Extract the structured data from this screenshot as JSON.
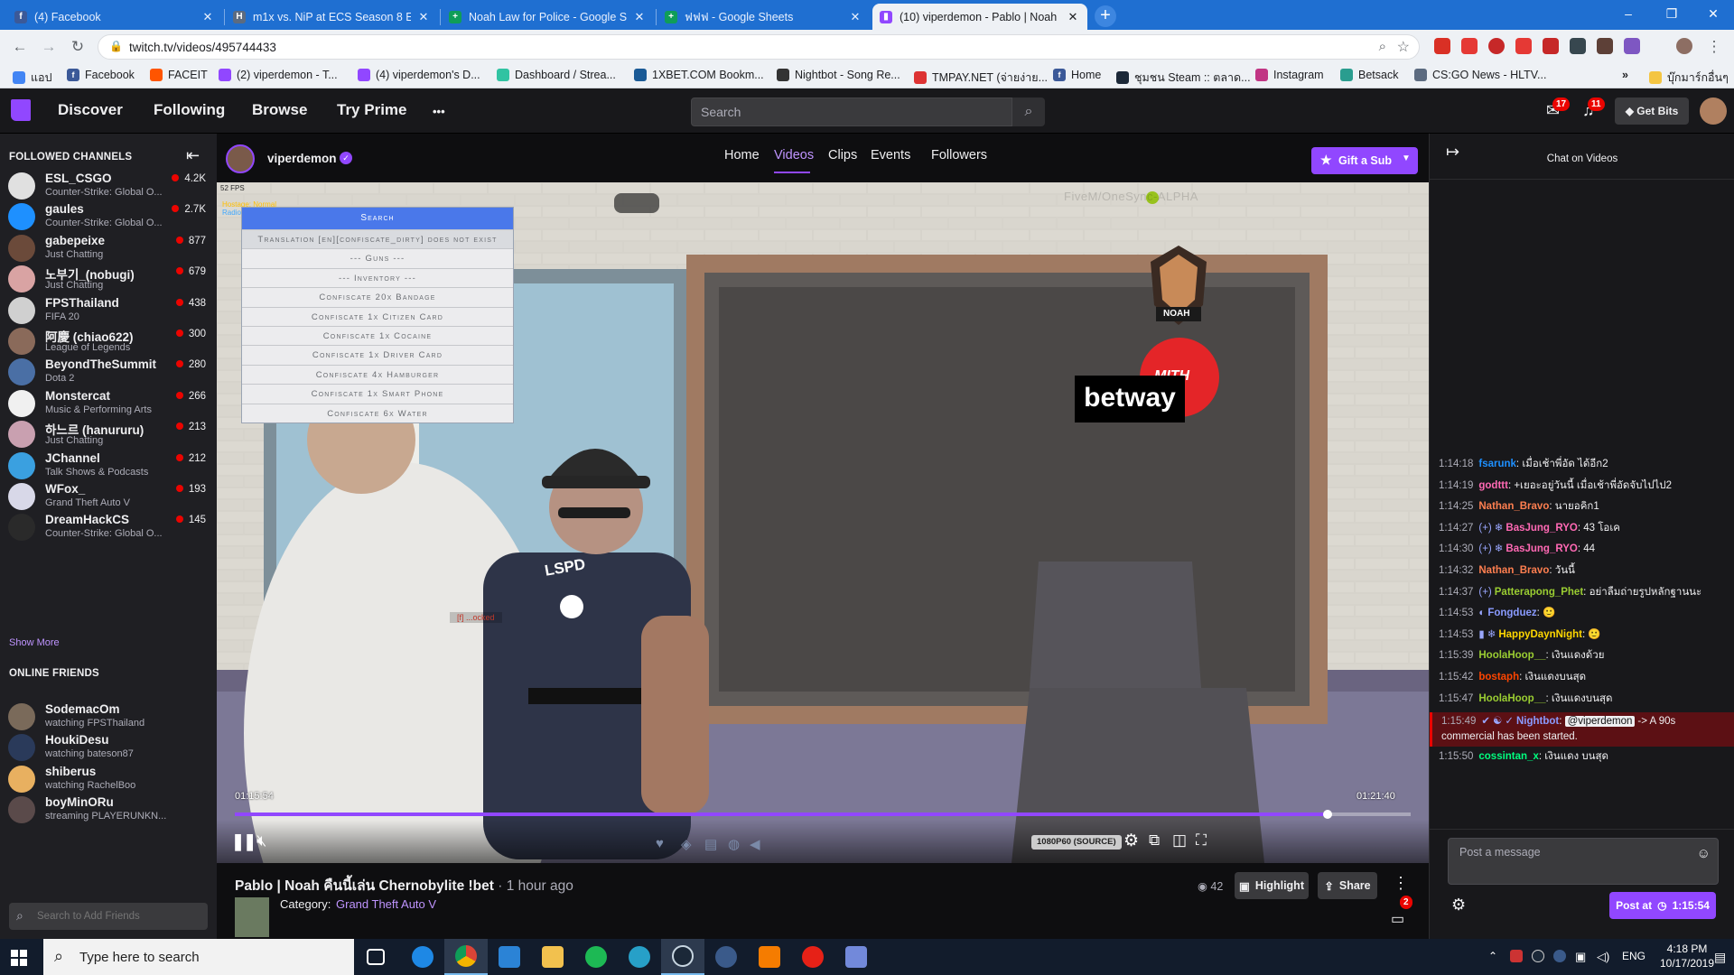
{
  "browser": {
    "tabs": [
      {
        "title": "(4) Facebook",
        "icon": "facebook-icon",
        "color": "#3b5998"
      },
      {
        "title": "m1x vs. NiP at ECS Season 8 Euro",
        "icon": "hltv-icon",
        "color": "#5c6b80"
      },
      {
        "title": "Noah Law for Police - Google She",
        "icon": "sheets-icon",
        "color": "#0f9d58"
      },
      {
        "title": "ฟฟฟ - Google Sheets",
        "icon": "sheets-icon",
        "color": "#0f9d58"
      },
      {
        "title": "(10) viperdemon - Pablo | Noah",
        "icon": "twitch-icon",
        "color": "#9147ff",
        "active": true
      }
    ],
    "new_tab": "+",
    "url": "twitch.tv/videos/495744433",
    "window_buttons": [
      "–",
      "❐",
      "✕"
    ],
    "bookmarks": [
      {
        "label": "แอป",
        "color": "#4285f4"
      },
      {
        "label": "Facebook",
        "color": "#3b5998"
      },
      {
        "label": "FACEIT",
        "color": "#ff5500"
      },
      {
        "label": "(2) viperdemon - T...",
        "color": "#9147ff"
      },
      {
        "label": "(4) viperdemon's D...",
        "color": "#9147ff"
      },
      {
        "label": "Dashboard / Strea...",
        "color": "#31c3a2"
      },
      {
        "label": "1XBET.COM Bookm...",
        "color": "#1a5a96"
      },
      {
        "label": "Nightbot - Song Re...",
        "color": "#333333"
      },
      {
        "label": "TMPAY.NET (จ่ายง่าย...",
        "color": "#d33"
      },
      {
        "label": "Home",
        "color": "#3b5998"
      },
      {
        "label": "ชุมชน Steam :: ตลาด...",
        "color": "#1b2838"
      },
      {
        "label": "Instagram",
        "color": "#c13584"
      },
      {
        "label": "Betsack",
        "color": "#2a9d8f"
      },
      {
        "label": "CS:GO News - HLTV...",
        "color": "#5c6b80"
      },
      {
        "label": "»",
        "color": ""
      },
      {
        "label": "บุ๊กมาร์กอื่นๆ",
        "color": "#f4c542"
      }
    ]
  },
  "twitch": {
    "nav": {
      "discover": "Discover",
      "following": "Following",
      "browse": "Browse",
      "try_prime": "Try Prime",
      "more": "•••"
    },
    "search_placeholder": "Search",
    "inbox_count": "17",
    "notif_count": "11",
    "get_bits": "Get Bits",
    "colors": {
      "purple": "#9147ff",
      "live": "#eb0400"
    }
  },
  "sidebar": {
    "followed_header": "FOLLOWED CHANNELS",
    "collapse_icon": "⇤",
    "channels": [
      {
        "name": "ESL_CSGO",
        "game": "Counter-Strike: Global O...",
        "viewers": "4.2K",
        "color": "#e0e0e0"
      },
      {
        "name": "gaules",
        "game": "Counter-Strike: Global O...",
        "viewers": "2.7K",
        "color": "#1e90ff"
      },
      {
        "name": "gabepeixe",
        "game": "Just Chatting",
        "viewers": "877",
        "color": "#6b4a3a"
      },
      {
        "name": "노부기_(nobugi)",
        "game": "Just Chatting",
        "viewers": "679",
        "color": "#d9a3a3"
      },
      {
        "name": "FPSThailand",
        "game": "FIFA 20",
        "viewers": "438",
        "color": "#d0d0d0"
      },
      {
        "name": "阿慶 (chiao622)",
        "game": "League of Legends",
        "viewers": "300",
        "color": "#8a6a5a"
      },
      {
        "name": "BeyondTheSummit",
        "game": "Dota 2",
        "viewers": "280",
        "color": "#4a6fa5"
      },
      {
        "name": "Monstercat",
        "game": "Music & Performing Arts",
        "viewers": "266",
        "color": "#f0f0f0"
      },
      {
        "name": "하느르 (hanururu)",
        "game": "Just Chatting",
        "viewers": "213",
        "color": "#c9a0b0"
      },
      {
        "name": "JChannel",
        "game": "Talk Shows & Podcasts",
        "viewers": "212",
        "color": "#3aa0e0"
      },
      {
        "name": "WFox_",
        "game": "Grand Theft Auto V",
        "viewers": "193",
        "color": "#d8d8e8"
      },
      {
        "name": "DreamHackCS",
        "game": "Counter-Strike: Global O...",
        "viewers": "145",
        "color": "#2a2a2a"
      }
    ],
    "show_more": "Show More",
    "friends_header": "ONLINE FRIENDS",
    "friends": [
      {
        "name": "SodemacOm",
        "status": "watching FPSThailand",
        "color": "#7a6a5a"
      },
      {
        "name": "HoukiDesu",
        "status": "watching bateson87",
        "color": "#2a3a5a"
      },
      {
        "name": "shiberus",
        "status": "watching RachelBoo",
        "color": "#e8b060"
      },
      {
        "name": "boyMinORu",
        "status": "streaming PLAYERUNKN...",
        "color": "#5a4a4a"
      }
    ],
    "search_friends_placeholder": "Search to Add Friends"
  },
  "channel": {
    "name": "viperdemon",
    "verified": "✓",
    "tabs": [
      "Home",
      "Videos",
      "Clips",
      "Events",
      "Followers"
    ],
    "active_tab": "Videos",
    "gift_sub": "Gift a Sub"
  },
  "video": {
    "fps": "52 FPS",
    "hud_top": "Hostage: Normal",
    "hud_sub": "Radio: LSPD Radio",
    "server_watermark": "FiveM/OneSync-ALPHA",
    "menu_title": "Search",
    "menu_items": [
      "Translation [en][confiscate_dirty] does not exist",
      "--- Guns ---",
      "--- Inventory ---",
      "Confiscate 20x Bandage",
      "Confiscate 1x Citizen Card",
      "Confiscate 1x Cocaine",
      "Confiscate 1x Driver Card",
      "Confiscate 4x Hamburger",
      "Confiscate 1x Smart Phone",
      "Confiscate 6x Water"
    ],
    "sponsor_betway": "betway",
    "sponsor_noah": "NOAH",
    "sponsor_mith": "MITH",
    "badge_text": "LSPD",
    "overhead_tag": "[f] ...ocked",
    "time_current": "01:15:54",
    "time_total": "01:21:40",
    "progress": 0.9294,
    "quality": "1080P60 (SOURCE)"
  },
  "video_info": {
    "title": "Pablo | Noah คืนนี้เล่น Chernobylite !bet",
    "time_ago": "· 1 hour ago",
    "category_label": "Category:",
    "category": "Grand Theft Auto V",
    "views": "42",
    "highlight": "Highlight",
    "share": "Share",
    "more": "⋮",
    "cheer_count": "2"
  },
  "chat": {
    "expand_icon": "↦",
    "title": "Chat on Videos",
    "messages": [
      {
        "time": "1:14:18",
        "user": "fsarunk",
        "color": "#1e90ff",
        "badges": [],
        "text": "เมื่อเช้าพี่อัด ได้อีก2"
      },
      {
        "time": "1:14:19",
        "user": "godttt",
        "color": "#ff69b4",
        "badges": [],
        "text": "+เยอะอยู่วันนี้ เมื่อเช้าพี่อัดจับไปไป2"
      },
      {
        "time": "1:14:25",
        "user": "Nathan_Bravo",
        "color": "#ff7f50",
        "badges": [],
        "text": "นายอคิก1"
      },
      {
        "time": "1:14:27",
        "user": "BasJung_RYO",
        "color": "#ff69b4",
        "badges": [
          "(+)",
          "❄"
        ],
        "text": "43 โอเค"
      },
      {
        "time": "1:14:30",
        "user": "BasJung_RYO",
        "color": "#ff69b4",
        "badges": [
          "(+)",
          "❄"
        ],
        "text": "44"
      },
      {
        "time": "1:14:32",
        "user": "Nathan_Bravo",
        "color": "#ff7f50",
        "badges": [],
        "text": "วันนี้"
      },
      {
        "time": "1:14:37",
        "user": "Patterapong_Phet",
        "color": "#9acd32",
        "badges": [
          "(+)"
        ],
        "text": "อย่าลืมถ่ายรูปหลักฐานนะ"
      },
      {
        "time": "1:14:53",
        "user": "Fongduez",
        "color": "#8a9bff",
        "badges": [
          "◐"
        ],
        "text": "🙂"
      },
      {
        "time": "1:14:53",
        "user": "HappyDaynNight",
        "color": "#ffd700",
        "badges": [
          "▮",
          "❄"
        ],
        "text": "🙂"
      },
      {
        "time": "1:15:39",
        "user": "HoolaHoop__",
        "color": "#9acd32",
        "badges": [],
        "text": "เงินแดงด้วย"
      },
      {
        "time": "1:15:42",
        "user": "bostaph",
        "color": "#ff4500",
        "badges": [],
        "text": "เงินแดงบนสุด"
      },
      {
        "time": "1:15:47",
        "user": "HoolaHoop__",
        "color": "#9acd32",
        "badges": [],
        "text": "เงินแดงบนสุด"
      },
      {
        "time": "1:15:49",
        "user": "Nightbot",
        "color": "#8a9bff",
        "badges": [
          "✔",
          "☯",
          "✓"
        ],
        "mention": "@viperdemon",
        "text": "-> A 90s commercial has been started.",
        "highlight": true
      },
      {
        "time": "1:15:50",
        "user": "cossintan_x",
        "color": "#00ff7f",
        "badges": [],
        "text": "เงินแดง บนสุด"
      }
    ],
    "input_placeholder": "Post a message",
    "post_at": "Post at",
    "post_time": "1:15:54"
  },
  "taskbar": {
    "search_placeholder": "Type here to search",
    "apps": [
      "task-view",
      "edge",
      "chrome",
      "store",
      "file-explorer",
      "spotify",
      "app-w",
      "steam",
      "app-blue",
      "app-orange",
      "app-youtube",
      "app-discord"
    ],
    "lang": "ENG",
    "time": "4:18 PM",
    "date": "10/17/2019",
    "tray_chevron": "⌃"
  }
}
